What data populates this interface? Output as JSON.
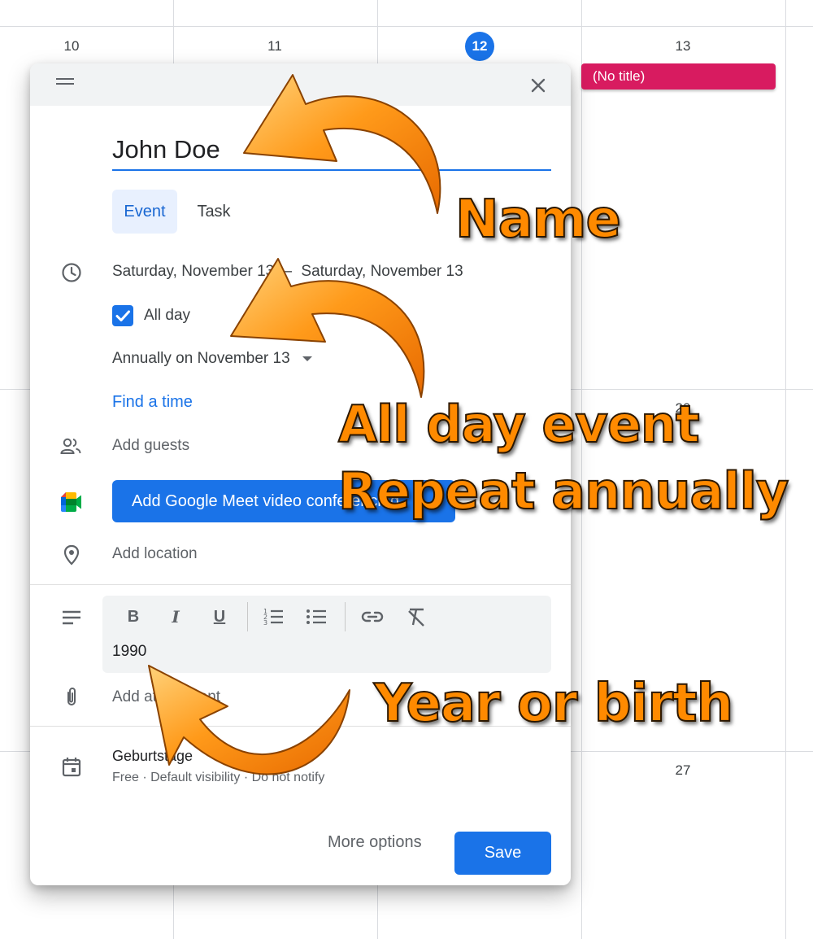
{
  "calendar": {
    "days": [
      "10",
      "11",
      "12",
      "13",
      "20",
      "27"
    ],
    "today": "12",
    "event_chip": "(No title)"
  },
  "dialog": {
    "title_value": "John Doe",
    "tabs": [
      "Event",
      "Task"
    ],
    "start_date": "Saturday, November 13",
    "date_separator": "–",
    "end_date": "Saturday, November 13",
    "all_day_label": "All day",
    "recurrence": "Annually on November 13",
    "find_time": "Find a time",
    "add_guests": "Add guests",
    "meet_button": "Add Google Meet video conferencing",
    "add_location": "Add location",
    "description": "1990",
    "add_attachment": "Add attachment",
    "calendar_name": "Geburtstage",
    "calendar_details": "Free · Default visibility · Do not notify",
    "more_options": "More options",
    "save": "Save"
  },
  "annotations": {
    "name": "Name",
    "all_day_line1": "All day event",
    "all_day_line2": "Repeat annually",
    "year": "Year or birth"
  },
  "colors": {
    "accent": "#1a73e8",
    "event_chip": "#d81b60",
    "annotation": "#ff8a00"
  }
}
